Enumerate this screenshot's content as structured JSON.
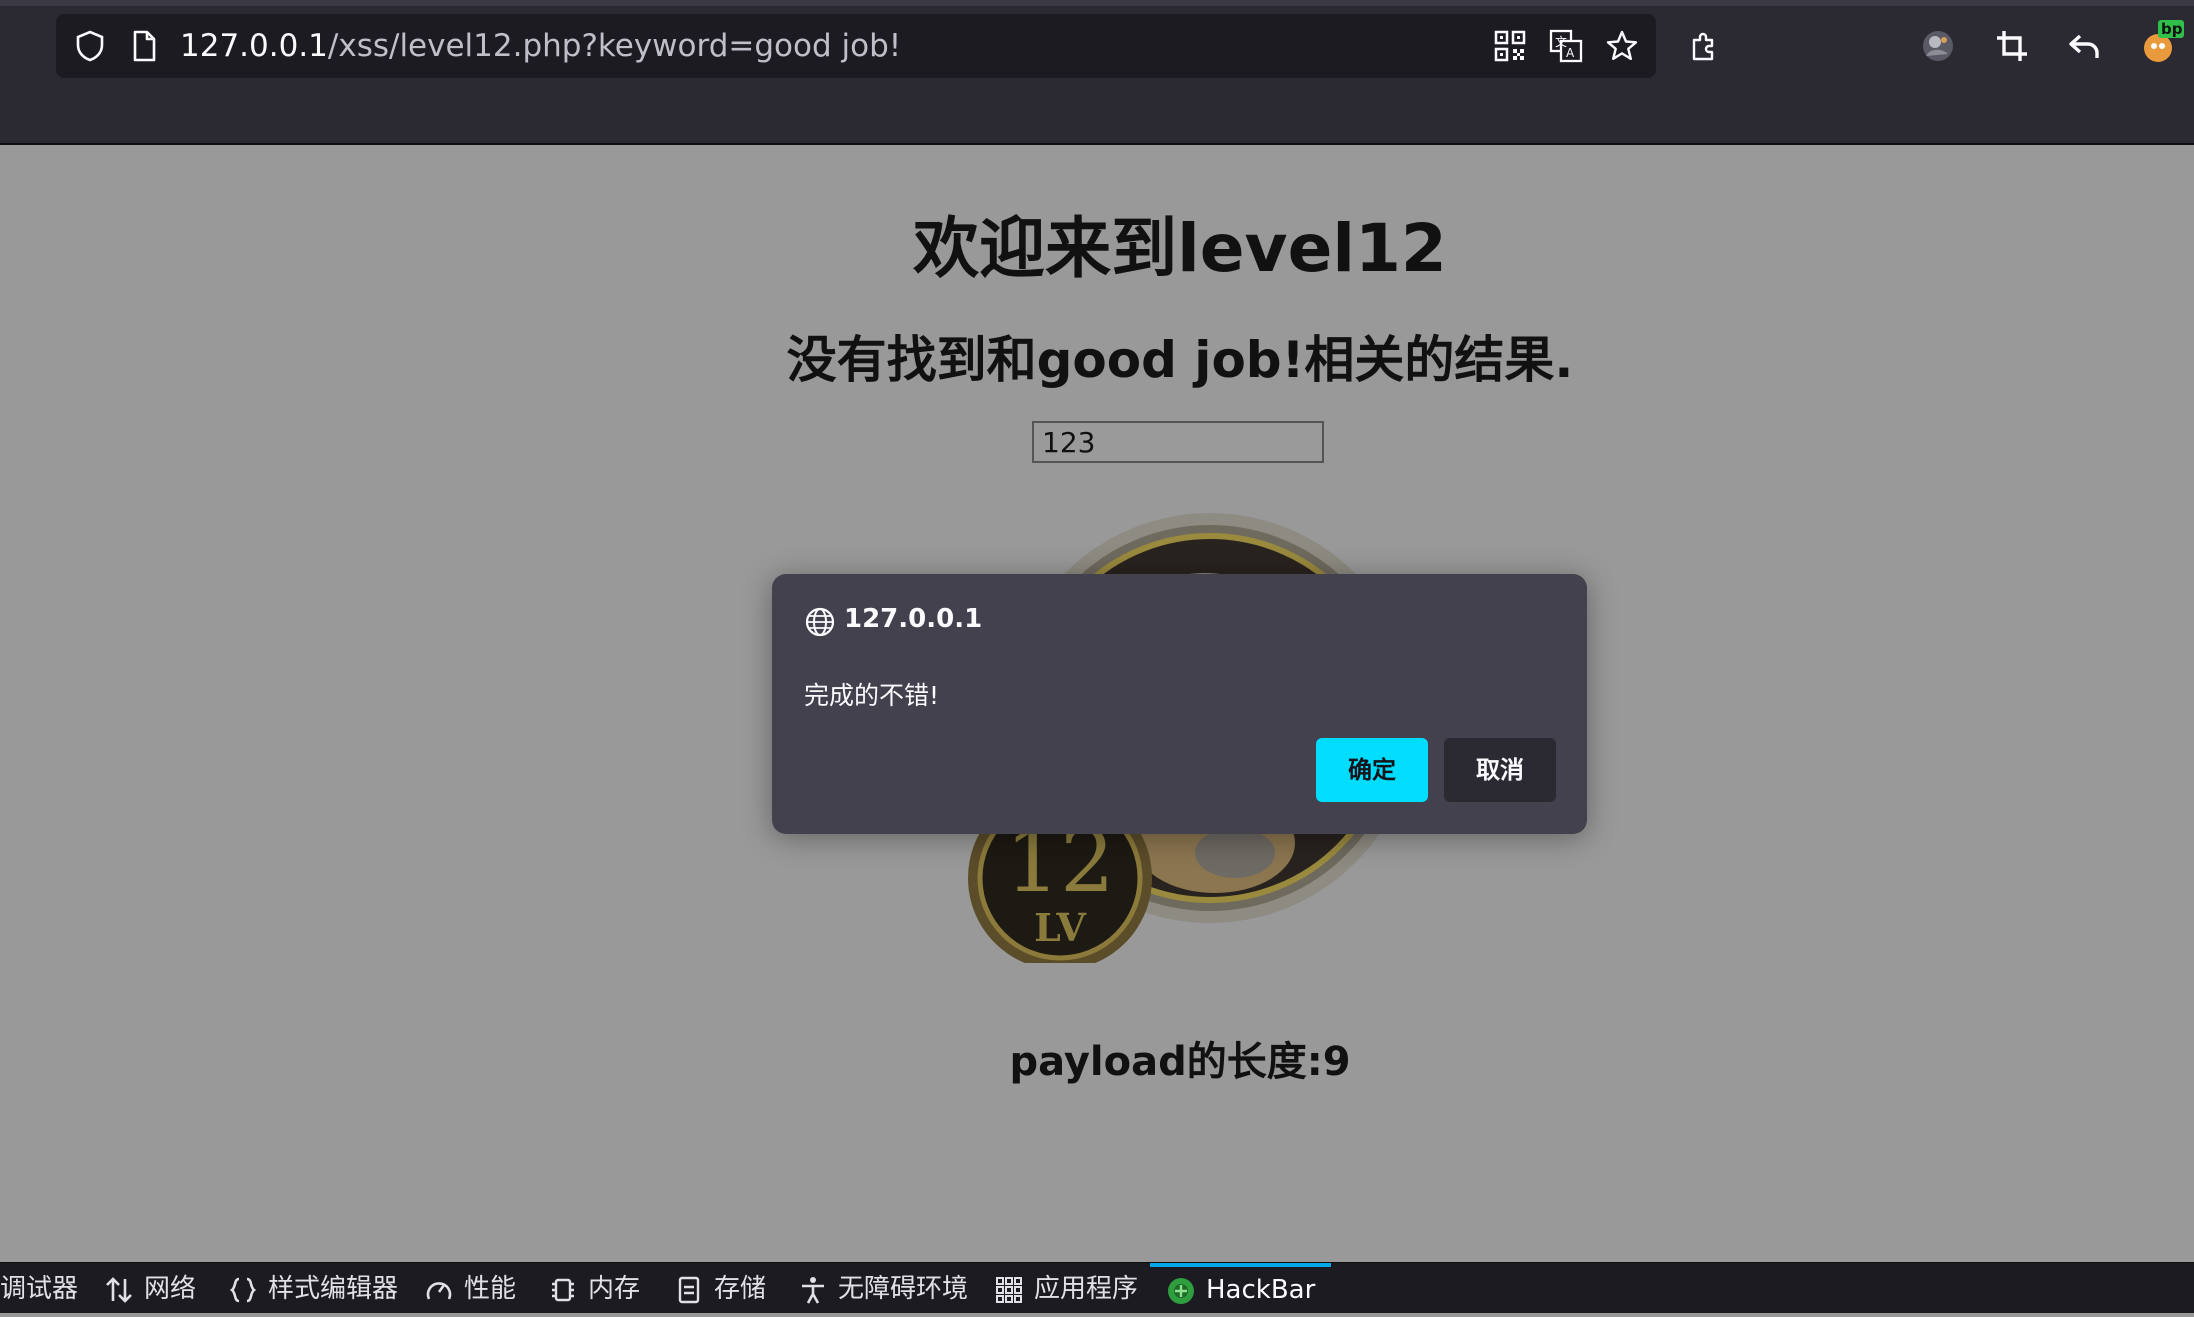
{
  "browser": {
    "url_host": "127.0.0.1",
    "url_path": "/xss/level12.php?keyword=good job!",
    "extension_badge": "bp"
  },
  "page": {
    "heading": "欢迎来到level12",
    "result_text": "没有找到和good job!相关的结果.",
    "input_value": "123",
    "badge_number": "12",
    "badge_lv": "LV",
    "payload_text": "payload的长度:9"
  },
  "dialog": {
    "host": "127.0.0.1",
    "message": "完成的不错!",
    "ok_label": "确定",
    "cancel_label": "取消"
  },
  "devtools": {
    "tabs": [
      {
        "label": "调试器",
        "icon": "debugger-icon"
      },
      {
        "label": "网络",
        "icon": "network-arrows-icon"
      },
      {
        "label": "样式编辑器",
        "icon": "braces-icon"
      },
      {
        "label": "性能",
        "icon": "gauge-icon"
      },
      {
        "label": "内存",
        "icon": "chip-icon"
      },
      {
        "label": "存储",
        "icon": "storage-icon"
      },
      {
        "label": "无障碍环境",
        "icon": "accessibility-icon"
      },
      {
        "label": "应用程序",
        "icon": "grid-icon"
      },
      {
        "label": "HackBar",
        "icon": "hackbar-icon"
      }
    ],
    "active_tab": "HackBar"
  },
  "colors": {
    "chrome_bg": "#2b2a33",
    "page_overlay": "#999999",
    "dialog_bg": "#42414d",
    "ok_button": "#00ddff",
    "active_tab_indicator": "#00a7e8"
  }
}
